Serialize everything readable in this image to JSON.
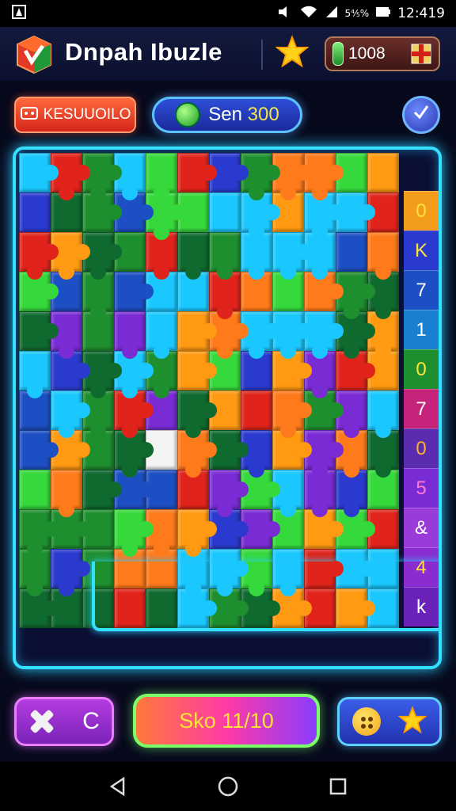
{
  "status": {
    "battery_text": "5⅘%",
    "time": "12:419"
  },
  "header": {
    "title": "Dnpah Ibuzle",
    "coins": "1008"
  },
  "controls": {
    "restart_label": "KESUUOILO",
    "score_label": "Sen",
    "score_value": "300",
    "hint_icon": "check-icon"
  },
  "board": {
    "columns": 13,
    "rows": 12,
    "side_numbers": [
      "0",
      "K",
      "7",
      "1",
      "0",
      "7",
      "0",
      "5",
      "&",
      "4",
      "k"
    ],
    "missing_piece": {
      "row": 7,
      "col": 4
    }
  },
  "footer": {
    "cancel_label": "C",
    "level_label": "Sko 11/10",
    "bonus_icons": [
      "smiley-icon",
      "star-icon"
    ]
  },
  "colors": {
    "frame_glow": "#33e0ff",
    "piece_palette": [
      "#1e8f2e",
      "#ff7a1a",
      "#e0241c",
      "#7a2cd4",
      "#1ac8ff",
      "#2a3acf",
      "#36d93b",
      "#0f6a2f",
      "#1d4fc4",
      "#ff9a12"
    ]
  }
}
